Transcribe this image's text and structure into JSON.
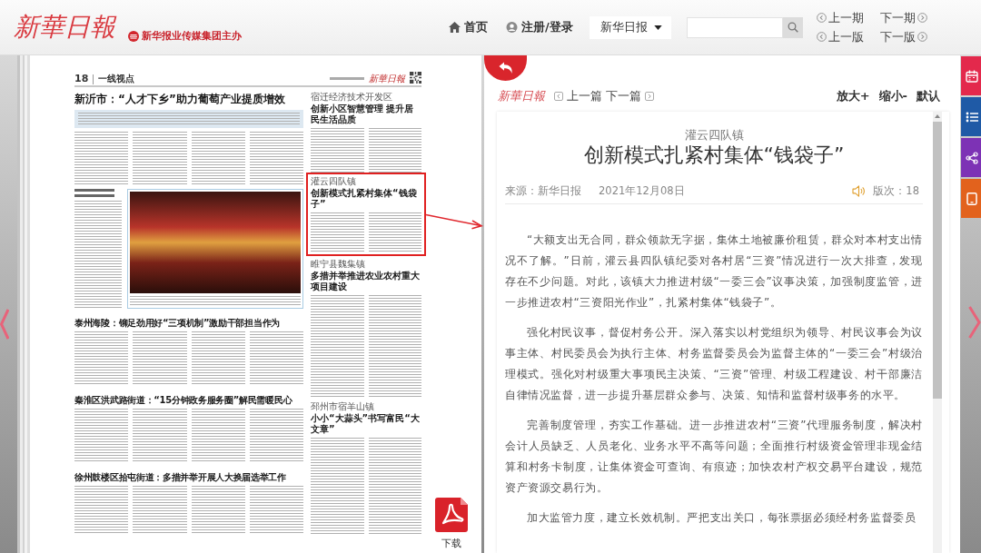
{
  "header": {
    "logo": "新華日報",
    "tagline": "新华报业传媒集团主办",
    "nav": [
      {
        "kind": "home",
        "label": "首页"
      },
      {
        "kind": "user",
        "label": "注册/登录"
      }
    ],
    "paper_select": "新华日报",
    "issue_nav": [
      {
        "kind": "prev",
        "label": "上一期"
      },
      {
        "kind": "next",
        "label": "下一期"
      },
      {
        "kind": "prev",
        "label": "上一版"
      },
      {
        "kind": "next",
        "label": "下一版"
      }
    ]
  },
  "newspaper": {
    "page_number": "18",
    "section": "一线视点",
    "masthead": "新華日報",
    "lead_headline": "新沂市：“人才下乡”助力葡萄产业提质增效",
    "stories": [
      {
        "headline": "泰州海陵：铆足劲用好“三项机制”激励干部担当作为"
      },
      {
        "headline": "秦淮区洪武路街道：“15分钟政务服务圈”解民需暖民心"
      },
      {
        "headline": "徐州鼓楼区拾屯街道：多措并举开展人大换届选举工作"
      }
    ],
    "side_stories": [
      {
        "kicker": "宿迁经济技术开发区",
        "headline": "创新小区智慧管理 提升居民生活品质",
        "highlighted": false
      },
      {
        "kicker": "灌云四队镇",
        "headline": "创新模式扎紧村集体“钱袋子”",
        "highlighted": true
      },
      {
        "kicker": "睢宁县魏集镇",
        "headline": "多措并举推进农业农村重大项目建设",
        "highlighted": false
      },
      {
        "kicker": "邳州市宿羊山镇",
        "headline": "小小“大蒜头”书写富民“大文章”",
        "highlighted": false
      }
    ]
  },
  "download": {
    "label": "下载"
  },
  "article_panel": {
    "logo": "新華日報",
    "article_nav": [
      {
        "kind": "prev",
        "label": "上一篇"
      },
      {
        "kind": "next",
        "label": "下一篇"
      }
    ],
    "text_size": [
      "放大+",
      "缩小-",
      "默认"
    ],
    "kicker": "灌云四队镇",
    "title": "创新模式扎紧村集体“钱袋子”",
    "source": "来源：新华日报",
    "date": "2021年12月08日",
    "edition": "版次：18",
    "paragraphs": [
      "“大额支出无合同，群众领款无字据，集体土地被廉价租赁，群众对本村支出情况不了解。”日前，灌云县四队镇纪委对各村居“三资”情况进行一次大排查，发现存在不少问题。对此，该镇大力推进村级“一委三会”议事决策，加强制度监管，进一步推进农村“三资阳光作业”，扎紧村集体“钱袋子”。",
      "强化村民议事，督促村务公开。深入落实以村党组织为领导、村民议事会为议事主体、村民委员会为执行主体、村务监督委员会为监督主体的“一委三会”村级治理模式。强化对村级重大事项民主决策、“三资”管理、村级工程建设、村干部廉洁自律情况监督，进一步提升基层群众参与、决策、知情和监督村级事务的水平。",
      "完善制度管理，夯实工作基础。进一步推进农村“三资”代理服务制度，解决村会计人员缺乏、人员老化、业务水平不高等问题；全面推行村级资金管理非现金结算和村务卡制度，让集体资金可查询、有痕迹；加快农村产权交易平台建设，规范资产资源交易行为。",
      "加大监管力度，建立长效机制。严把支出关口，每张票据必须经村务监督委员"
    ]
  },
  "side_tabs": [
    {
      "kind": "calendar",
      "color": "#e3294c"
    },
    {
      "kind": "list",
      "color": "#1f5aa6"
    },
    {
      "kind": "share",
      "color": "#7d32b5"
    },
    {
      "kind": "tablet",
      "color": "#e2621d"
    }
  ]
}
